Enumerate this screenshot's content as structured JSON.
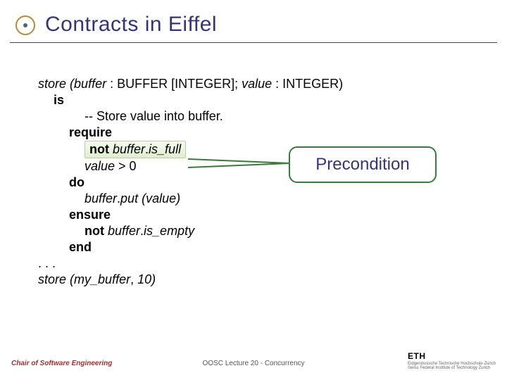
{
  "header": {
    "title": "Contracts in Eiffel"
  },
  "code": {
    "sig1a": "store",
    "sig1b": "(buffer",
    "sig1c": ": BUFFER [INTEGER]; ",
    "sig1d": "value",
    "sig1e": ": INTEGER)",
    "is": "is",
    "comment": "-- Store value into buffer.",
    "require": "require",
    "cond1a": "not ",
    "cond1b": "buffer",
    "cond1c": ".",
    "cond1d": "is_full",
    "cond2a": "value",
    "cond2b": " > 0",
    "do": "do",
    "body1a": "buffer",
    "body1b": ".",
    "body1c": "put ",
    "body1d": "(value)",
    "ensure": "ensure",
    "post1a": "not ",
    "post1b": "buffer",
    "post1c": ".",
    "post1d": "is_empty",
    "end": "end",
    "dots": ". . .",
    "call1a": "store",
    "call1b": "(my_buffer",
    "call1c": ", ",
    "call1d": "10",
    "call1e": ")"
  },
  "callout": {
    "label": "Precondition"
  },
  "footer": {
    "left": "Chair of Software Engineering",
    "center": "OOSC  Lecture 20 - Concurrency",
    "logo": "ETH",
    "logo_sub1": "Eidgenössische Technische Hochschule Zürich",
    "logo_sub2": "Swiss Federal Institute of Technology Zurich"
  }
}
